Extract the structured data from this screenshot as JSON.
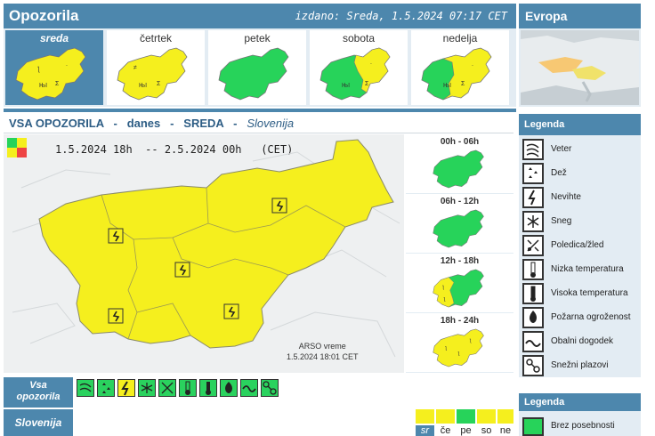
{
  "header": {
    "title": "Opozorila",
    "issued": "izdano: Sreda, 1.5.2024 07:17 CET",
    "europe_title": "Evropa"
  },
  "days": [
    {
      "label": "sreda",
      "selected": true,
      "fill": "yellow"
    },
    {
      "label": "četrtek",
      "selected": false,
      "fill": "yellow"
    },
    {
      "label": "petek",
      "selected": false,
      "fill": "green"
    },
    {
      "label": "sobota",
      "selected": false,
      "fill": "mixed-east"
    },
    {
      "label": "nedelja",
      "selected": false,
      "fill": "mixed-west"
    }
  ],
  "section": {
    "a": "VSA OPOZORILA",
    "sep": "-",
    "b": "danes",
    "c": "SREDA",
    "d": "Slovenija"
  },
  "main": {
    "time_range": "1.5.2024 18h  -- 2.5.2024 00h   (CET)",
    "credit_line1": "ARSO vreme",
    "credit_line2": "1.5.2024  18:01 CET"
  },
  "slots": [
    {
      "label": "00h - 06h",
      "fill": "green"
    },
    {
      "label": "06h - 12h",
      "fill": "green"
    },
    {
      "label": "12h - 18h",
      "fill": "mixed-west"
    },
    {
      "label": "18h - 24h",
      "fill": "yellow"
    }
  ],
  "legend": {
    "title": "Legenda",
    "items": [
      {
        "name": "Veter",
        "icon": "wind-icon"
      },
      {
        "name": "Dež",
        "icon": "rain-icon"
      },
      {
        "name": "Nevihte",
        "icon": "thunderstorm-icon"
      },
      {
        "name": "Sneg",
        "icon": "snow-icon"
      },
      {
        "name": "Poledica/žled",
        "icon": "ice-icon"
      },
      {
        "name": "Nizka temperatura",
        "icon": "low-temperature-icon"
      },
      {
        "name": "Visoka temperatura",
        "icon": "high-temperature-icon"
      },
      {
        "name": "Požarna ogroženost",
        "icon": "fire-danger-icon"
      },
      {
        "name": "Obalni dogodek",
        "icon": "coastal-event-icon"
      },
      {
        "name": "Snežni plazovi",
        "icon": "avalanche-icon"
      }
    ]
  },
  "legend2": {
    "title": "Legenda",
    "item": "Brez posebnosti",
    "color": "#27d35a"
  },
  "warnings_row": {
    "label_line1": "Vsa",
    "label_line2": "opozorila",
    "icons": [
      "wind-icon",
      "rain-icon",
      "thunderstorm-icon",
      "snow-icon",
      "ice-icon",
      "low-temperature-icon",
      "high-temperature-icon",
      "fire-danger-icon",
      "coastal-event-icon",
      "avalanche-icon"
    ],
    "active_index": 2
  },
  "slovenia_row": {
    "label": "Slovenija",
    "days": [
      {
        "abbr": "sr",
        "color": "#f5ef1e",
        "selected": true
      },
      {
        "abbr": "če",
        "color": "#f5ef1e",
        "selected": false
      },
      {
        "abbr": "pe",
        "color": "#27d35a",
        "selected": false
      },
      {
        "abbr": "so",
        "color": "#f5ef1e",
        "selected": false
      },
      {
        "abbr": "ne",
        "color": "#f5ef1e",
        "selected": false
      }
    ]
  },
  "colors": {
    "yellow": "#f5ef1e",
    "green": "#27d35a",
    "header_blue": "#4d87ad",
    "light_blue": "#e3ecf3"
  }
}
